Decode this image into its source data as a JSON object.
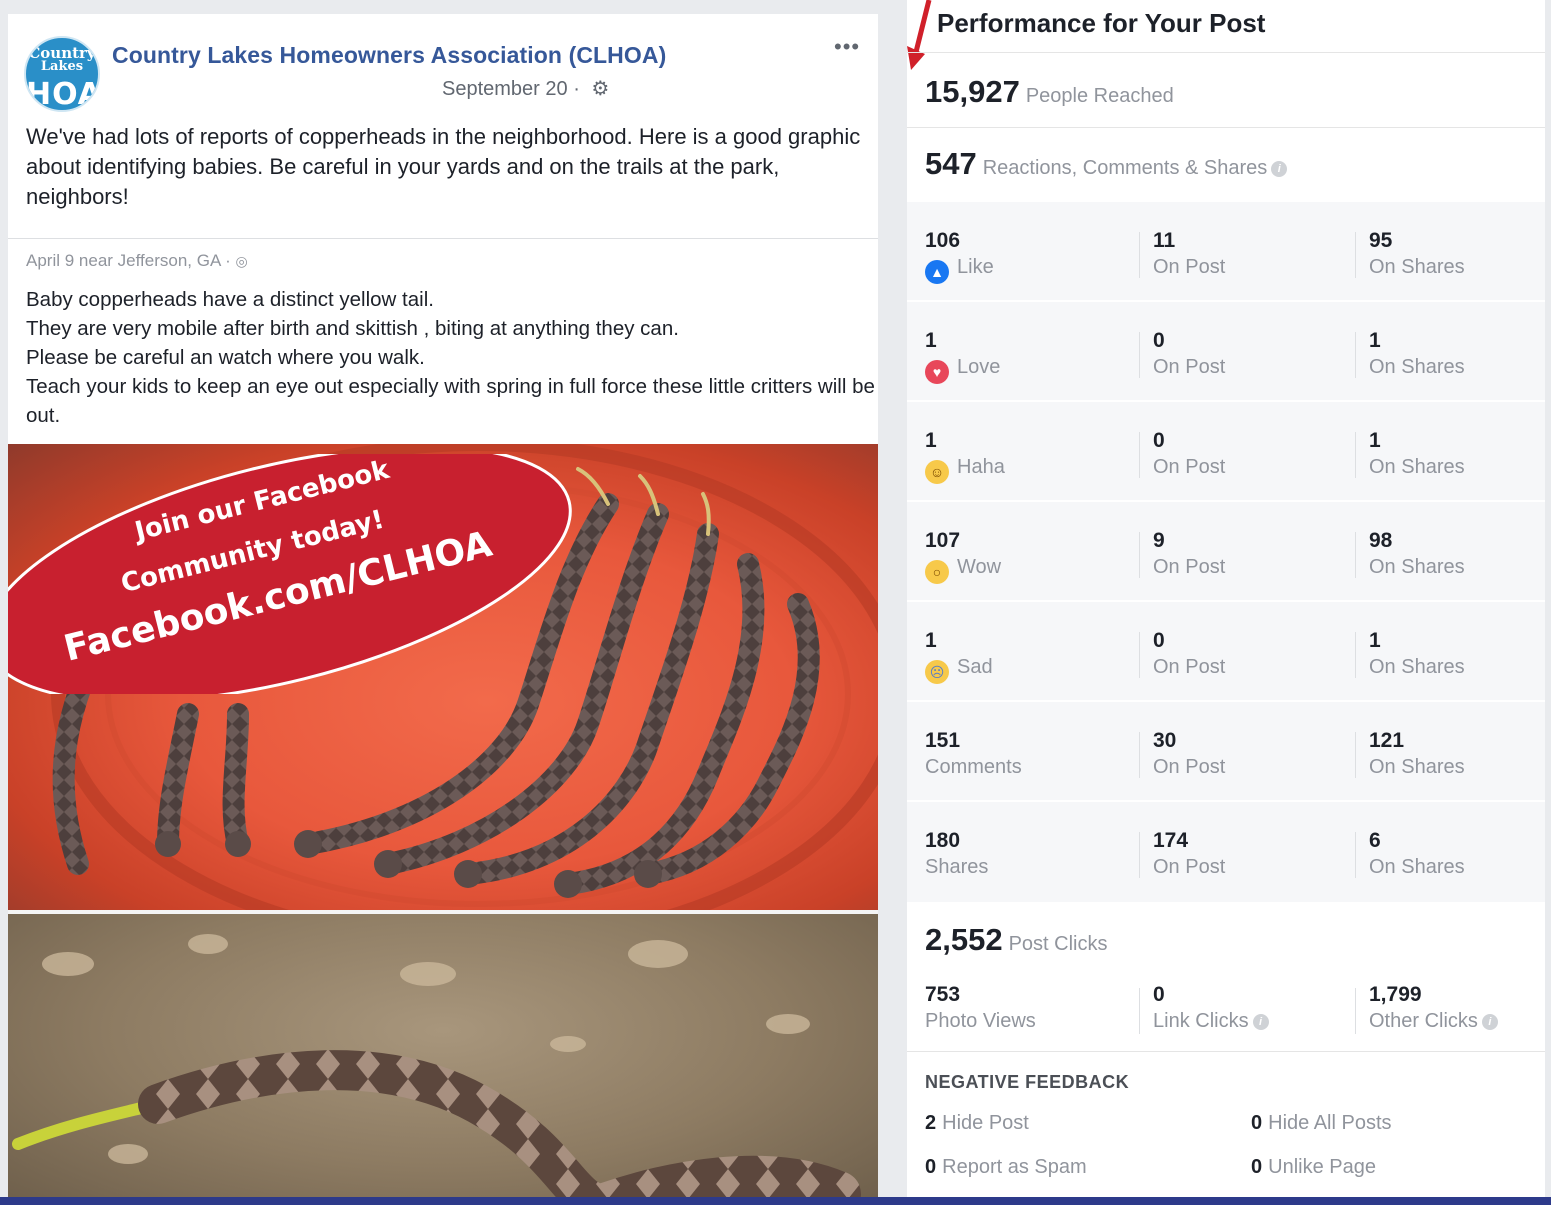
{
  "post": {
    "page_name": "Country Lakes Homeowners Association (CLHOA)",
    "date": "September 20 ·",
    "more": "•••",
    "avatar_lines": [
      "Country",
      "Lakes",
      "HOA"
    ],
    "text": "We've had lots of reports of copperheads in the neighborhood. Here is a good graphic about identifying babies. Be careful in your yards and on the trails at the park, neighbors!",
    "shared": {
      "meta": "April 9 near Jefferson, GA · ",
      "lines": [
        "Baby copperheads have a distinct yellow tail.",
        "They are very mobile after birth and skittish , biting at anything they can.",
        "Please be careful an watch where you walk.",
        "Teach your kids to keep an eye out especially with spring in full force these little critters will be out."
      ]
    },
    "promo": {
      "line1": "Join our Facebook",
      "line2": "Community today!",
      "line3": "Facebook.com/CLHOA",
      "color": "#c8202f"
    }
  },
  "insights": {
    "title": "Performance for Your Post",
    "people_reached": {
      "value": "15,927",
      "label": "People Reached"
    },
    "engagement": {
      "value": "547",
      "label": "Reactions, Comments & Shares"
    },
    "rows": [
      {
        "total": "106",
        "label": "Like",
        "emoji": "like",
        "on_post": "11",
        "on_shares": "95"
      },
      {
        "total": "1",
        "label": "Love",
        "emoji": "love",
        "on_post": "0",
        "on_shares": "1"
      },
      {
        "total": "1",
        "label": "Haha",
        "emoji": "haha",
        "on_post": "0",
        "on_shares": "1"
      },
      {
        "total": "107",
        "label": "Wow",
        "emoji": "wow",
        "on_post": "9",
        "on_shares": "98"
      },
      {
        "total": "1",
        "label": "Sad",
        "emoji": "sad",
        "on_post": "0",
        "on_shares": "1"
      },
      {
        "total": "151",
        "label": "Comments",
        "emoji": "",
        "on_post": "30",
        "on_shares": "121"
      },
      {
        "total": "180",
        "label": "Shares",
        "emoji": "",
        "on_post": "174",
        "on_shares": "6"
      }
    ],
    "on_post_label": "On Post",
    "on_shares_label": "On Shares",
    "post_clicks": {
      "value": "2,552",
      "label": "Post Clicks"
    },
    "clicks": [
      {
        "value": "753",
        "label": "Photo Views",
        "info": false
      },
      {
        "value": "0",
        "label": "Link Clicks",
        "info": true
      },
      {
        "value": "1,799",
        "label": "Other Clicks",
        "info": true
      }
    ],
    "negative": {
      "title": "NEGATIVE FEEDBACK",
      "items": [
        {
          "value": "2",
          "label": "Hide Post"
        },
        {
          "value": "0",
          "label": "Hide All Posts"
        },
        {
          "value": "0",
          "label": "Report as Spam"
        },
        {
          "value": "0",
          "label": "Unlike Page"
        }
      ]
    }
  },
  "colors": {
    "link_blue": "#365899",
    "muted": "#90949c",
    "arrow_red": "#d0202a",
    "bottom_bar": "#2d3a8a"
  }
}
